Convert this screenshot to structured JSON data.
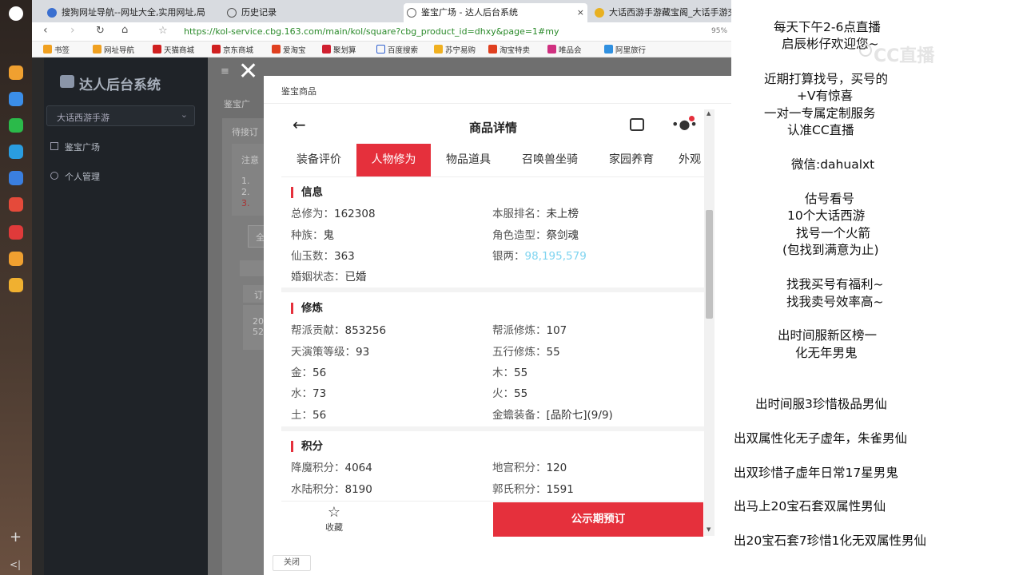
{
  "browser": {
    "tabs": [
      "搜狗网址导航--网址大全,实用网址,局",
      "历史记录",
      "鉴宝广场 - 达人后台系统",
      "大话西游手游藏宝阁_大话手游交"
    ],
    "url": "https://kol-service.cbg.163.com/main/kol/square?cbg_product_id=dhxy&page=1#my",
    "zoom": "95%",
    "bookmarks": [
      "书签",
      "网址导航",
      "天猫商城",
      "京东商城",
      "爱淘宝",
      "聚划算",
      "百度搜索",
      "苏宁易购",
      "淘宝特卖",
      "唯品会",
      "阿里旅行"
    ]
  },
  "app": {
    "title": "达人后台系统",
    "product_select": "大话西游手游",
    "menu": [
      "鉴宝广场",
      "个人管理"
    ],
    "bg_fragments": [
      "鉴宝广",
      "待接订",
      "注意",
      "1.",
      "2.",
      "3.",
      "全",
      "订",
      "20",
      "52"
    ]
  },
  "modal": {
    "crumb": "鉴宝商品",
    "close_label": "关闭",
    "header_title": "商品详情",
    "tabs": [
      "装备评价",
      "人物修为",
      "物品道具",
      "召唤兽坐骑",
      "家园养育",
      "外观"
    ],
    "sections": {
      "info": {
        "title": "信息",
        "rows": [
          {
            "k": "总修为：",
            "v": "162308"
          },
          {
            "k": "本服排名：",
            "v": "未上榜"
          },
          {
            "k": "种族：",
            "v": "鬼"
          },
          {
            "k": "角色造型：",
            "v": "祭剑魂"
          },
          {
            "k": "仙玉数：",
            "v": "363"
          },
          {
            "k": "银两：",
            "v": "98,195,579"
          },
          {
            "k": "婚姻状态：",
            "v": "已婚"
          }
        ]
      },
      "train": {
        "title": "修炼",
        "rows": [
          {
            "k": "帮派贡献：",
            "v": "853256"
          },
          {
            "k": "帮派修炼：",
            "v": "107"
          },
          {
            "k": "天演策等级：",
            "v": "93"
          },
          {
            "k": "五行修炼：",
            "v": "55"
          },
          {
            "k": "金：",
            "v": "56"
          },
          {
            "k": "木：",
            "v": "55"
          },
          {
            "k": "水：",
            "v": "73"
          },
          {
            "k": "火：",
            "v": "55"
          },
          {
            "k": "土：",
            "v": "56"
          },
          {
            "k": "金蟾装备：",
            "v": "[品阶七](9/9)"
          }
        ]
      },
      "score": {
        "title": "积分",
        "rows": [
          {
            "k": "降魔积分：",
            "v": "4064"
          },
          {
            "k": "地宫积分：",
            "v": "120"
          },
          {
            "k": "水陆积分：",
            "v": "8190"
          },
          {
            "k": "郭氏积分：",
            "v": "1591"
          }
        ]
      }
    },
    "fav_label": "收藏",
    "preorder_label": "公示期预订"
  },
  "overlay": {
    "watermark": "CC直播",
    "lines": [
      "每天下午2-6点直播",
      "启辰彬仔欢迎您~",
      "近期打算找号，买号的",
      "+V有惊喜",
      "一对一专属定制服务",
      "认准CC直播",
      "微信:dahualxt",
      "估号看号",
      "10个大话西游",
      "找号一个火箭",
      "(包找到满意为止)",
      "找我买号有福利~",
      "找我卖号效率高~",
      "出时间服新区榜一",
      "化无年男鬼",
      "出时间服3珍惜极品男仙",
      "出双属性化无子虚年，朱雀男仙",
      "出双珍惜子虚年日常17星男鬼",
      "出马上20宝石套双属性男仙",
      "出20宝石套7珍惜1化无双属性男仙"
    ]
  },
  "colors": {
    "accent": "#e5303c",
    "silver": "#7fd4f0"
  }
}
